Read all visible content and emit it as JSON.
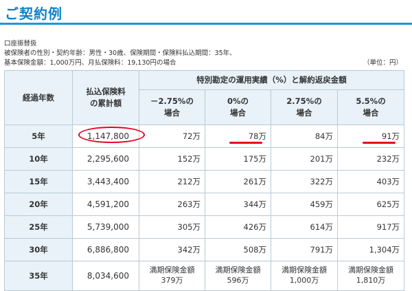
{
  "title": "ご契約例",
  "meta": {
    "line1": "口座振替扱",
    "line2": "被保険者の性別・契約年齢：男性・30歳、保険期間・保険料払込期間：35年、",
    "line3": "基本保険金額：1,000万円、月払保険料：19,130円の場合",
    "unit": "（単位：円）"
  },
  "table": {
    "headers": {
      "year": "経過年数",
      "cumulative": [
        "払込保険料",
        "の累計額"
      ],
      "group": "特別勘定の運用実績（%）と解約返戻金額",
      "scenarios": [
        [
          "－2.75%の",
          "場合"
        ],
        [
          "0%の",
          "場合"
        ],
        [
          "2.75%の",
          "場合"
        ],
        [
          "5.5%の",
          "場合"
        ]
      ]
    },
    "rows": [
      {
        "year": "5年",
        "cumulative": "1,147,800",
        "values": [
          "72万",
          "78万",
          "84万",
          "91万"
        ]
      },
      {
        "year": "10年",
        "cumulative": "2,295,600",
        "values": [
          "152万",
          "175万",
          "201万",
          "232万"
        ]
      },
      {
        "year": "15年",
        "cumulative": "3,443,400",
        "values": [
          "212万",
          "261万",
          "322万",
          "403万"
        ]
      },
      {
        "year": "20年",
        "cumulative": "4,591,200",
        "values": [
          "263万",
          "344万",
          "459万",
          "625万"
        ]
      },
      {
        "year": "25年",
        "cumulative": "5,739,000",
        "values": [
          "305万",
          "426万",
          "614万",
          "917万"
        ]
      },
      {
        "year": "30年",
        "cumulative": "6,886,800",
        "values": [
          "342万",
          "508万",
          "791万",
          "1,304万"
        ]
      }
    ],
    "final_row": {
      "year": "35年",
      "cumulative": "8,034,600",
      "label": "満期保険金額",
      "values": [
        "379万",
        "596万",
        "1,000万",
        "1,810万"
      ]
    }
  },
  "highlight_color": "#e8001d",
  "accent_color": "#1e96d7"
}
